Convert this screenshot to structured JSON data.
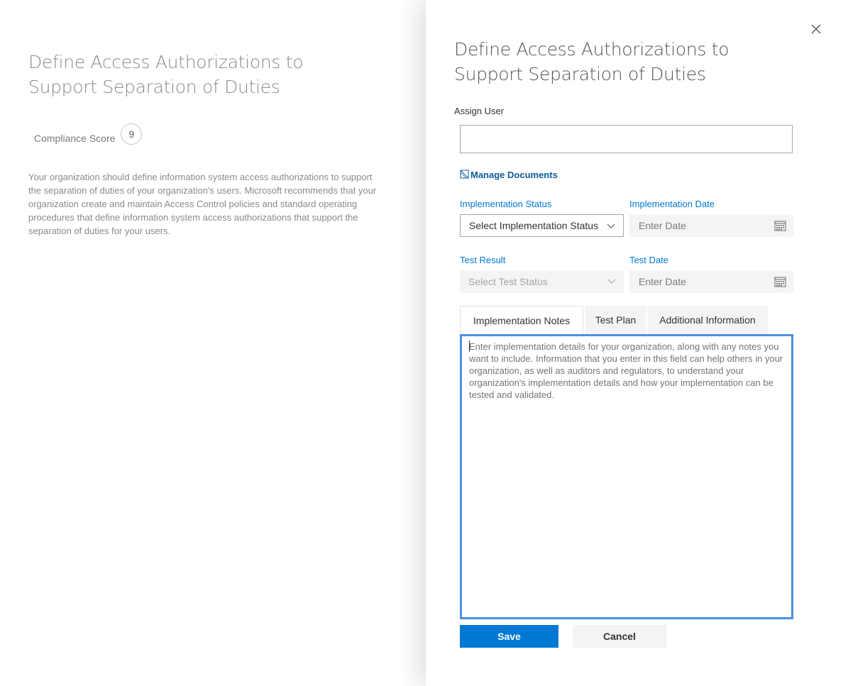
{
  "left": {
    "title": "Define Access Authorizations to Support Separation of Duties",
    "score_label": "Compliance Score",
    "score_value": "9",
    "description": "Your organization should define information system access authorizations to support the separation of duties of your organization's users. Microsoft recommends that your organization create and maintain Access Control policies and standard operating procedures that define information system access authorizations that support the separation of duties for your users."
  },
  "panel": {
    "close_icon": "close-icon",
    "title": "Define Access Authorizations to Support Separation of Duties",
    "assign_user": {
      "label": "Assign User",
      "value": ""
    },
    "manage_documents": {
      "label": "Manage Documents",
      "icon": "document-icon"
    },
    "implementation_status": {
      "label": "Implementation Status",
      "selected": "Select Implementation Status"
    },
    "implementation_date": {
      "label": "Implementation Date",
      "placeholder": "Enter Date"
    },
    "test_result": {
      "label": "Test Result",
      "selected": "Select Test Status"
    },
    "test_date": {
      "label": "Test Date",
      "placeholder": "Enter Date"
    },
    "tabs": [
      {
        "label": "Implementation Notes",
        "active": true
      },
      {
        "label": "Test Plan",
        "active": false
      },
      {
        "label": "Additional Information",
        "active": false
      }
    ],
    "notes_placeholder": "Enter implementation details for your organization, along with any notes you want to include. Information that you enter in this field can help others in your organization, as well as auditors and regulators, to understand your organization's implementation details and how your implementation can be tested and validated.",
    "buttons": {
      "save": "Save",
      "cancel": "Cancel"
    }
  },
  "colors": {
    "accent": "#0078d4",
    "focus_border": "#4a90e2",
    "link": "#0a5c99",
    "field_bg": "#f4f4f4"
  }
}
